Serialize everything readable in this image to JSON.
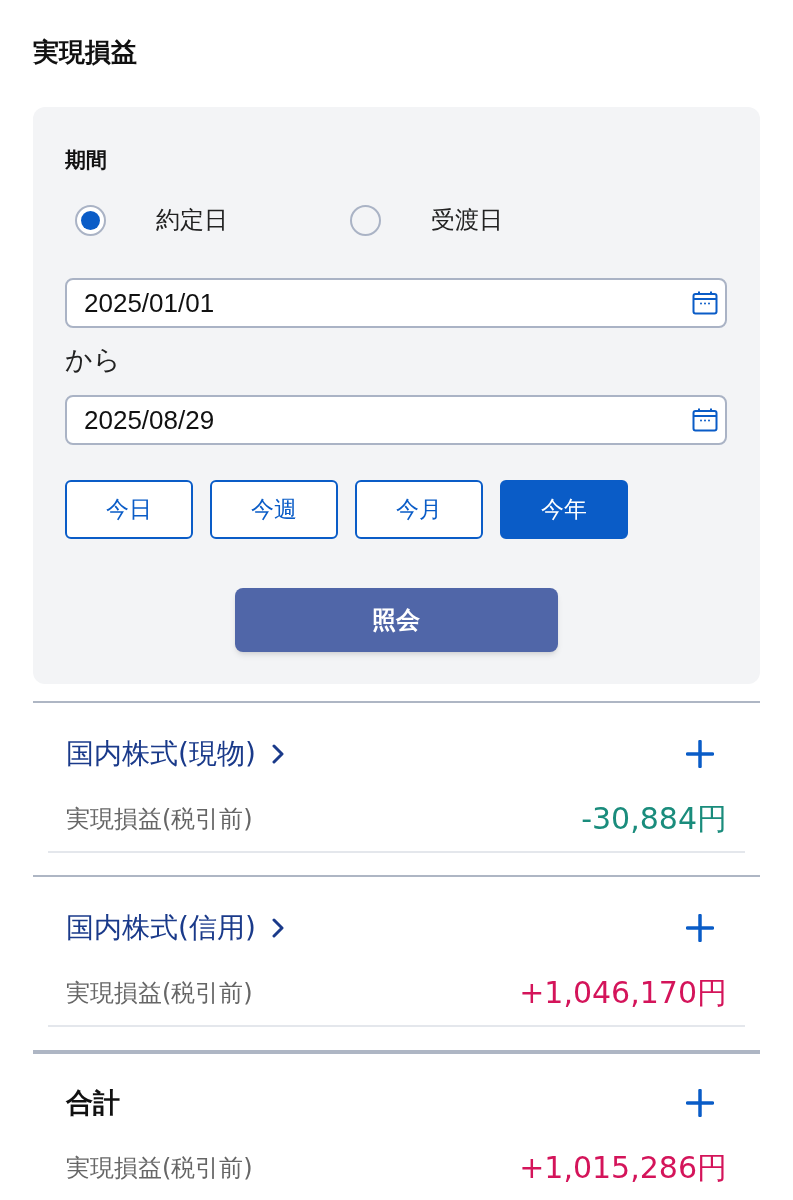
{
  "title": "実現損益",
  "period": {
    "label": "期間",
    "date_basis": [
      {
        "label": "約定日",
        "selected": true
      },
      {
        "label": "受渡日",
        "selected": false
      }
    ],
    "from": {
      "value": "2025/01/01"
    },
    "separator": "から",
    "to": {
      "value": "2025/08/29"
    },
    "presets": [
      {
        "label": "今日",
        "selected": false
      },
      {
        "label": "今週",
        "selected": false
      },
      {
        "label": "今月",
        "selected": false
      },
      {
        "label": "今年",
        "selected": true
      }
    ],
    "submit": "照会"
  },
  "sections": [
    {
      "kind": "link",
      "title": "国内株式(現物)",
      "expanded": false,
      "rows": [
        {
          "label": "実現損益(税引前)",
          "value": "-30,884円",
          "color": "#1a8c7c"
        }
      ]
    },
    {
      "kind": "link",
      "title": "国内株式(信用)",
      "expanded": false,
      "rows": [
        {
          "label": "実現損益(税引前)",
          "value": "+1,046,170円",
          "color": "#d4145a"
        }
      ]
    },
    {
      "kind": "total",
      "title": "合計",
      "expanded": false,
      "rows": [
        {
          "label": "実現損益(税引前)",
          "value": "+1,015,286円",
          "color": "#d4145a"
        }
      ]
    }
  ]
}
